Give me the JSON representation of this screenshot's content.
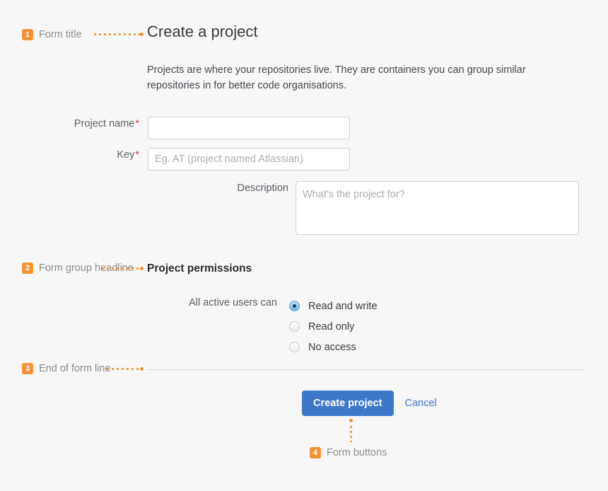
{
  "page": {
    "background_color": "#f7f7f7",
    "accent_orange": "#f79232",
    "accent_blue": "#3d79c9",
    "required_red": "#d04437"
  },
  "annotations": [
    {
      "number": "1",
      "label": "Form title"
    },
    {
      "number": "2",
      "label": "Form group headline"
    },
    {
      "number": "3",
      "label": "End of form line"
    },
    {
      "number": "4",
      "label": "Form buttons"
    }
  ],
  "form": {
    "title": "Create a project",
    "description": "Projects are where your repositories live. They are containers you can group similar repositories in for better code organisations.",
    "fields": [
      {
        "label": "Project name",
        "required_marker": "*",
        "value": "",
        "placeholder": ""
      },
      {
        "label": "Key",
        "required_marker": "*",
        "value": "",
        "placeholder": "Eg. AT (project named Atlassian)"
      },
      {
        "label": "Description",
        "required_marker": "",
        "value": "",
        "placeholder": "What's the project for?"
      }
    ],
    "group": {
      "headline": "Project permissions",
      "radio_label": "All active users can",
      "options": [
        {
          "label": "Read and write",
          "selected": true
        },
        {
          "label": "Read only",
          "selected": false
        },
        {
          "label": "No access",
          "selected": false
        }
      ]
    },
    "actions": {
      "submit_label": "Create project",
      "cancel_label": "Cancel"
    }
  }
}
